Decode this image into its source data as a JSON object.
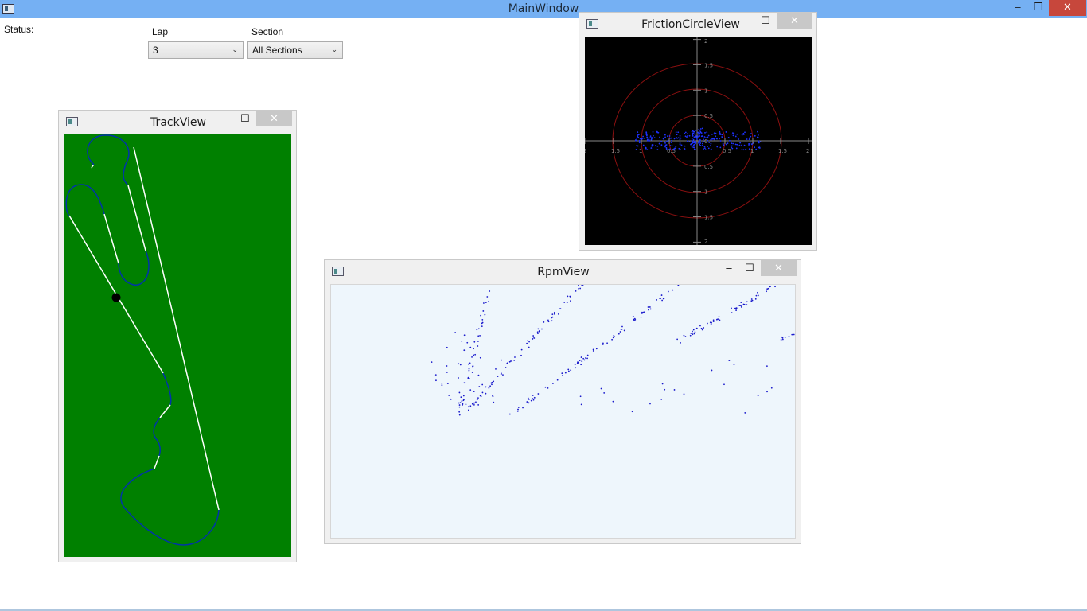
{
  "main_window": {
    "title": "MainWindow",
    "minimize": "–",
    "restore": "❐",
    "close": "✕"
  },
  "status": {
    "label": "Status:"
  },
  "lap": {
    "label": "Lap",
    "selected": "3"
  },
  "section": {
    "label": "Section",
    "selected": "All Sections"
  },
  "track_view": {
    "title": "TrackView",
    "minimize": "–",
    "maximize": "☐",
    "close": "✕",
    "colors": {
      "background": "#008000",
      "straight": "#ffffff",
      "corner": "#0033aa",
      "marker": "#000000"
    }
  },
  "friction_view": {
    "title": "FrictionCircleView",
    "minimize": "–",
    "maximize": "☐",
    "close": "✕",
    "x_ticks": [
      "2",
      "1.5",
      "1",
      "0.5",
      "0.5",
      "1",
      "1.5",
      "2"
    ],
    "y_ticks": [
      "2",
      "1.5",
      "1",
      "0.5",
      "0",
      "0.5",
      "1",
      "1.5",
      "2"
    ],
    "colors": {
      "background": "#000000",
      "circles": "#8b1010",
      "points": "#1e32ff",
      "axes": "#888888"
    }
  },
  "rpm_view": {
    "title": "RpmView",
    "minimize": "–",
    "maximize": "☐",
    "close": "✕",
    "colors": {
      "background": "#eef6fc",
      "points": "#1a1acc"
    }
  }
}
